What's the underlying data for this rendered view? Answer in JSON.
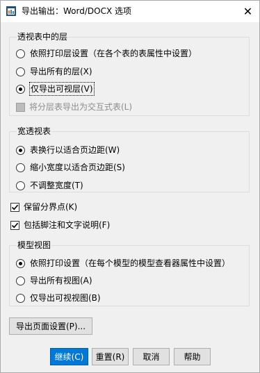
{
  "window": {
    "title": "导出输出：Word/DOCX 选项",
    "close_label": "✕"
  },
  "layers_group": {
    "title": "透视表中的层",
    "options": [
      {
        "label": "依照打印层设置（在各个表的表属性中设置）",
        "selected": false
      },
      {
        "label": "导出所有的层(X)",
        "selected": false
      },
      {
        "label": "仅导出可视层(V)",
        "selected": true
      }
    ],
    "interactive_checkbox": {
      "label": "将分层表导出为交互式表(L)",
      "checked": false,
      "disabled": true
    }
  },
  "wide_group": {
    "title": "宽透视表",
    "options": [
      {
        "label": "表换行以适合页边距(W)",
        "selected": true
      },
      {
        "label": "缩小宽度以适合页边距(S)",
        "selected": false
      },
      {
        "label": "不调整宽度(T)",
        "selected": false
      }
    ]
  },
  "checkboxes": [
    {
      "label": "保留分界点(K)",
      "checked": true
    },
    {
      "label": "包括脚注和文字说明(F)",
      "checked": true
    }
  ],
  "model_group": {
    "title": "模型视图",
    "options": [
      {
        "label": "依照打印设置（在每个模型的模型查看器属性中设置）",
        "selected": true
      },
      {
        "label": "导出所有视图(A)",
        "selected": false
      },
      {
        "label": "仅导出可视视图(B)",
        "selected": false
      }
    ]
  },
  "buttons": {
    "page_setup": "导出页面设置(P)...",
    "continue": "继续(C)",
    "reset": "重置(R)",
    "cancel": "取消",
    "help": "帮助"
  },
  "colors": {
    "primary_button": "#0078d7",
    "dialog_bg": "#f0f0f0"
  }
}
